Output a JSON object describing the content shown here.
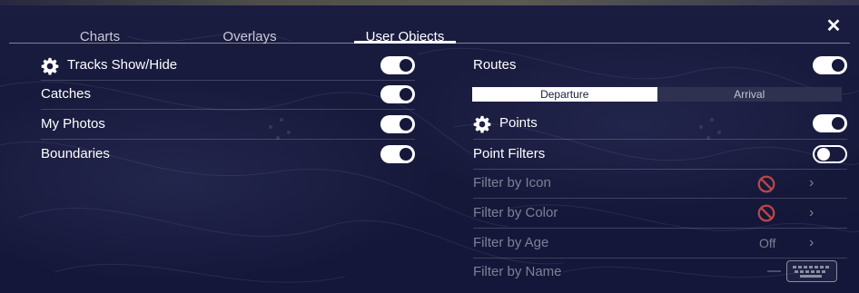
{
  "tabs": [
    {
      "label": "Charts",
      "active": false
    },
    {
      "label": "Overlays",
      "active": false
    },
    {
      "label": "User Objects",
      "active": true
    }
  ],
  "close_icon": "close-icon",
  "left": {
    "rows": [
      {
        "label": "Tracks Show/Hide",
        "icon": "gear-icon",
        "toggle": "on"
      },
      {
        "label": "Catches",
        "toggle": "on"
      },
      {
        "label": "My Photos",
        "toggle": "on"
      },
      {
        "label": "Boundaries",
        "toggle": "on"
      }
    ]
  },
  "right": {
    "routes": {
      "label": "Routes",
      "toggle": "on"
    },
    "route_mode": {
      "options": [
        "Departure",
        "Arrival"
      ],
      "selected": "Departure"
    },
    "points": {
      "label": "Points",
      "icon": "gear-icon",
      "toggle": "on"
    },
    "point_filters": {
      "label": "Point Filters",
      "toggle": "off"
    },
    "filters": [
      {
        "label": "Filter by Icon",
        "value_icon": "no-symbol-icon"
      },
      {
        "label": "Filter by Color",
        "value_icon": "no-symbol-icon"
      },
      {
        "label": "Filter by Age",
        "value": "Off"
      },
      {
        "label": "Filter by Name",
        "value": "—",
        "action_icon": "keyboard-icon"
      }
    ]
  },
  "colors": {
    "background": "#15183a",
    "text": "#ffffff",
    "disabled_text": "#7e8196",
    "no_symbol_red": "#b9474a"
  }
}
